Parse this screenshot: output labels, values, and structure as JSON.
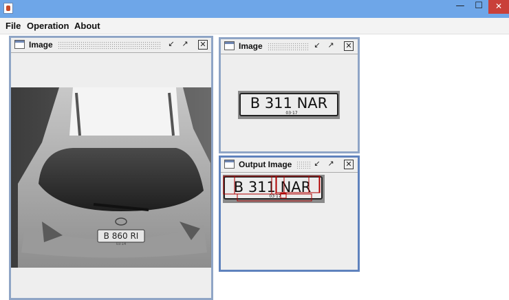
{
  "window": {
    "title": ""
  },
  "menu": [
    "File",
    "Operation",
    "About"
  ],
  "frames": {
    "left": {
      "title": "Image"
    },
    "top_right": {
      "title": "Image",
      "plate_text": "B 311 NAR",
      "plate_sub": "03·17"
    },
    "output": {
      "title": "Output Image",
      "plate_text": "B 311 NAR",
      "plate_sub": "03·17"
    }
  },
  "car_plate": {
    "text": "B 860 RI",
    "sub": "03·14"
  },
  "icons": {
    "app": "java-app-icon",
    "minimize": "window-minimize-icon",
    "maximize": "window-maximize-icon",
    "close": "window-close-icon",
    "frame_iconify": "frame-iconify-icon",
    "frame_maximize": "frame-maximize-icon",
    "frame_close": "frame-close-icon"
  },
  "colors": {
    "titlebar": "#6ea6e8",
    "close": "#c9403a",
    "frame_border": "#8fa5c6",
    "detection_box": "#b00000"
  }
}
